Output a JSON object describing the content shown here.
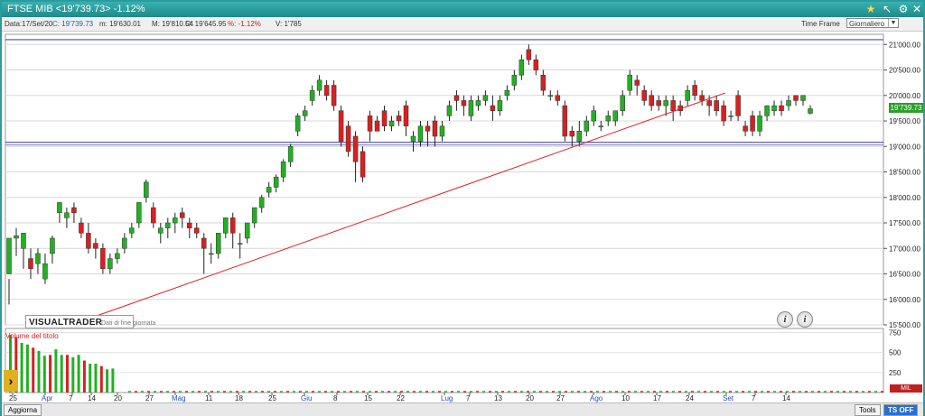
{
  "window": {
    "title": "FTSE MIB <19'739.73> -1.12%"
  },
  "infobar": {
    "data": "Data:17/Set/20",
    "close": "C: 19'739.73",
    "min": "m: 19'630.01",
    "max": "M: 19'810.54",
    "open": "O: 19'645.95",
    "pct": "%: -1.12%",
    "vol": "V: 1'785",
    "timeframe_label": "Time Frame",
    "timeframe_value": "Giornaliero"
  },
  "price_axis": [
    "21'000.00",
    "20'500.00",
    "20'000.00",
    "19'500.00",
    "19'000.00",
    "18'500.00",
    "18'000.00",
    "17'500.00",
    "17'000.00",
    "16'500.00",
    "16'000.00",
    "15'500.00"
  ],
  "price_label": "19'739.73",
  "volume_axis": [
    "750",
    "500",
    "250"
  ],
  "volume_label": "Volume del titolo",
  "volume_unit": "MIL",
  "logo": "VISUALTRADER",
  "eod_note": "Dati di fine giornata",
  "x_axis": [
    "25",
    "Apr",
    "7",
    "14",
    "20",
    "27",
    "Mag",
    "11",
    "18",
    "25",
    "Giu",
    "8",
    "15",
    "22",
    "Lug",
    "7",
    "13",
    "20",
    "27",
    "Ago",
    "10",
    "17",
    "24",
    "Set",
    "7",
    "14"
  ],
  "statusbar": {
    "left": "Aggiorna",
    "tools": "Tools",
    "ts": "TS OFF"
  },
  "chart_data": {
    "type": "candlestick",
    "ylim": [
      15500,
      21200
    ],
    "candles": [
      [
        16500,
        17200,
        16400,
        15900
      ],
      [
        17200,
        17250,
        16850,
        17400
      ],
      [
        17000,
        17300,
        16600,
        17300
      ],
      [
        16800,
        16600,
        16400,
        17000
      ],
      [
        16700,
        16900,
        16500,
        17000
      ],
      [
        16400,
        16700,
        16300,
        16900
      ],
      [
        16900,
        17200,
        16700,
        17250
      ],
      [
        17700,
        17900,
        17500,
        17900
      ],
      [
        17600,
        17700,
        17400,
        17800
      ],
      [
        17800,
        17700,
        17500,
        17900
      ],
      [
        17500,
        17300,
        17200,
        17600
      ],
      [
        17300,
        17000,
        16900,
        17500
      ],
      [
        17100,
        17000,
        16800,
        17200
      ],
      [
        17000,
        16600,
        16500,
        17100
      ],
      [
        16600,
        16800,
        16500,
        16900
      ],
      [
        16800,
        16900,
        16700,
        17000
      ],
      [
        17000,
        17200,
        16900,
        17300
      ],
      [
        17300,
        17400,
        17200,
        17500
      ],
      [
        17500,
        17900,
        17400,
        17900
      ],
      [
        18000,
        18300,
        17900,
        18350
      ],
      [
        17800,
        17500,
        17400,
        17900
      ],
      [
        17300,
        17400,
        17100,
        17500
      ],
      [
        17400,
        17500,
        17200,
        17600
      ],
      [
        17500,
        17600,
        17300,
        17700
      ],
      [
        17700,
        17600,
        17400,
        17800
      ],
      [
        17500,
        17400,
        17200,
        17600
      ],
      [
        17400,
        17300,
        17200,
        17500
      ],
      [
        17200,
        17000,
        16500,
        17300
      ],
      [
        16900,
        16900,
        16700,
        17100
      ],
      [
        16900,
        17300,
        16800,
        17300
      ],
      [
        17300,
        17600,
        17200,
        17600
      ],
      [
        17600,
        17300,
        17000,
        17700
      ],
      [
        17100,
        17100,
        16800,
        17300
      ],
      [
        17200,
        17500,
        17100,
        17500
      ],
      [
        17500,
        17800,
        17400,
        17800
      ],
      [
        17800,
        18000,
        17700,
        18050
      ],
      [
        18100,
        18200,
        18000,
        18300
      ],
      [
        18200,
        18400,
        18100,
        18450
      ],
      [
        18400,
        18700,
        18300,
        18750
      ],
      [
        18700,
        19000,
        18600,
        19050
      ],
      [
        19300,
        19600,
        19200,
        19650
      ],
      [
        19600,
        19700,
        19500,
        19800
      ],
      [
        19900,
        20100,
        19800,
        20200
      ],
      [
        20100,
        20300,
        20000,
        20400
      ],
      [
        20200,
        20000,
        19900,
        20300
      ],
      [
        20200,
        19800,
        19700,
        20300
      ],
      [
        19700,
        19100,
        19000,
        19800
      ],
      [
        19400,
        18900,
        18800,
        19500
      ],
      [
        19200,
        18700,
        18300,
        19300
      ],
      [
        18900,
        18400,
        18300,
        19000
      ],
      [
        19600,
        19300,
        19100,
        19700
      ],
      [
        19500,
        19300,
        19300,
        19600
      ],
      [
        19700,
        19400,
        19300,
        19800
      ],
      [
        19400,
        19500,
        19300,
        19600
      ],
      [
        19600,
        19500,
        19400,
        19700
      ],
      [
        19800,
        19400,
        19200,
        19900
      ],
      [
        19100,
        19200,
        18900,
        19300
      ],
      [
        19100,
        19400,
        19000,
        19500
      ],
      [
        19400,
        19300,
        19000,
        19500
      ],
      [
        19500,
        19200,
        19000,
        19600
      ],
      [
        19200,
        19400,
        19100,
        19500
      ],
      [
        19600,
        19800,
        19500,
        19900
      ],
      [
        20000,
        19900,
        19700,
        20100
      ],
      [
        19900,
        19800,
        19600,
        20000
      ],
      [
        19600,
        19900,
        19500,
        20000
      ],
      [
        19800,
        19900,
        19700,
        20000
      ],
      [
        19900,
        20000,
        19800,
        20100
      ],
      [
        19800,
        19700,
        19500,
        20000
      ],
      [
        19700,
        19900,
        19600,
        20000
      ],
      [
        20000,
        20100,
        19900,
        20200
      ],
      [
        20200,
        20400,
        20100,
        20500
      ],
      [
        20400,
        20700,
        20300,
        20800
      ],
      [
        20900,
        20700,
        20600,
        21000
      ],
      [
        20700,
        20500,
        20400,
        20800
      ],
      [
        20400,
        20100,
        20000,
        20500
      ],
      [
        20000,
        20000,
        19900,
        20100
      ],
      [
        20000,
        19900,
        19800,
        20100
      ],
      [
        19800,
        19200,
        19100,
        19900
      ],
      [
        19300,
        19200,
        19000,
        19400
      ],
      [
        19100,
        19300,
        19000,
        19500
      ],
      [
        19300,
        19500,
        19200,
        19600
      ],
      [
        19500,
        19700,
        19400,
        19800
      ],
      [
        19400,
        19400,
        19300,
        19500
      ],
      [
        19500,
        19600,
        19400,
        19700
      ],
      [
        19500,
        19700,
        19400,
        19700
      ],
      [
        19700,
        20000,
        19600,
        20100
      ],
      [
        20100,
        20400,
        20000,
        20500
      ],
      [
        20300,
        20200,
        20000,
        20400
      ],
      [
        20100,
        19900,
        19800,
        20200
      ],
      [
        20000,
        19800,
        19700,
        20100
      ],
      [
        19900,
        19800,
        19700,
        20000
      ],
      [
        19800,
        19900,
        19600,
        20000
      ],
      [
        19900,
        19700,
        19500,
        20000
      ],
      [
        19800,
        19700,
        19600,
        19900
      ],
      [
        19900,
        20100,
        19800,
        20200
      ],
      [
        20200,
        20000,
        19900,
        20300
      ],
      [
        20000,
        19900,
        19800,
        20100
      ],
      [
        19900,
        19800,
        19600,
        20000
      ],
      [
        19900,
        19700,
        19600,
        20000
      ],
      [
        19800,
        19500,
        19400,
        19900
      ],
      [
        19600,
        19600,
        19500,
        19700
      ],
      [
        20000,
        19600,
        19500,
        20100
      ],
      [
        19400,
        19300,
        19200,
        19500
      ],
      [
        19600,
        19300,
        19200,
        19700
      ],
      [
        19300,
        19600,
        19200,
        19700
      ],
      [
        19600,
        19800,
        19500,
        19800
      ],
      [
        19700,
        19800,
        19600,
        19900
      ],
      [
        19800,
        19700,
        19600,
        19900
      ],
      [
        19800,
        19900,
        19700,
        20000
      ],
      [
        20000,
        19900,
        19800,
        20000
      ],
      [
        19900,
        20000,
        19800,
        20000
      ],
      [
        19650,
        19740,
        19630,
        19810
      ]
    ],
    "volumes": [
      720,
      690,
      620,
      600,
      560,
      520,
      460,
      470,
      540,
      470,
      470,
      440,
      470,
      400,
      360,
      360,
      330,
      290,
      300,
      0,
      0,
      0,
      0,
      0
    ],
    "trendline": [
      [
        0.075,
        15500
      ],
      [
        0.82,
        20050
      ]
    ]
  }
}
